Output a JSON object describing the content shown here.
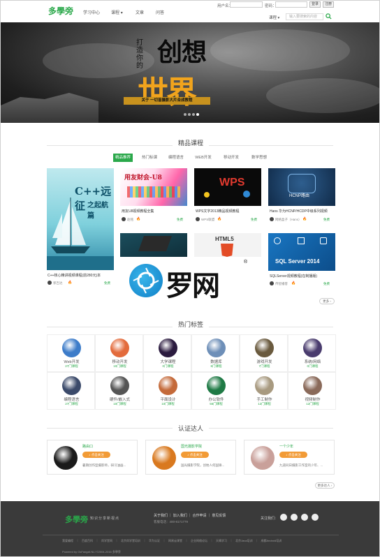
{
  "header": {
    "logo": "多學旁",
    "nav": [
      "学习中心",
      "课程",
      "文章",
      "问答"
    ],
    "login": {
      "username_label": "用户名：",
      "password_label": "密码：",
      "login_button": "登录",
      "register_button": "注册"
    },
    "course_select": "课程",
    "search_placeholder": "输入要搜索的内容"
  },
  "banner": {
    "small_text": "打造你的",
    "big_text_1": "创想",
    "big_text_2": "世界",
    "subtitle": "关于 一切皆摄影大片合成教程",
    "dots": 4,
    "active_dot": 3
  },
  "featured": {
    "title": "精品课程",
    "tabs": [
      "精品推荐",
      "热门标课",
      "编程语言",
      "WEB开发",
      "移动开发",
      "数学思想"
    ],
    "active_tab": 0,
    "big_card": {
      "title": "C++核心精讲视频课程(前280元)本",
      "author": "郭吉达",
      "price": "免费",
      "cover_text_1": "C++远征",
      "cover_text_2": "之起航篇"
    },
    "cards": [
      {
        "title": "用友U8视频教程全集",
        "author": "赵铭",
        "price": "免费",
        "cover": "用友财会-U8"
      },
      {
        "title": "WPS文字2013精品视频教程",
        "author": "WPS联盟",
        "price": "免费",
        "cover": "WPS"
      },
      {
        "title": "Hans 华为HCNP/HCDP中级系列视频",
        "author": "网络盒子（Hans）",
        "price": "免费",
        "cover": "HCNP路由"
      },
      {
        "title": "",
        "author": "",
        "price": "",
        "cover": ""
      },
      {
        "title": "",
        "author": "",
        "price": "",
        "cover": "HTML5"
      },
      {
        "title": "SQLServer视频教程(在制播版)",
        "author": "传智播客",
        "price": "免费",
        "cover": "SQL Server 2014"
      }
    ],
    "more_button": "更多 ›"
  },
  "watermark": {
    "text": "罗网",
    "reg": "®"
  },
  "tags": {
    "title": "热门标签",
    "items": [
      {
        "name": "Web开发",
        "count": "27门课程",
        "color": "#3d7cc9"
      },
      {
        "name": "移动开发",
        "count": "10门课程",
        "color": "#e36b3c"
      },
      {
        "name": "大学课程",
        "count": "0门课程",
        "color": "#2b1b3f"
      },
      {
        "name": "数据库",
        "count": "8门课程",
        "color": "#6e8fb8"
      },
      {
        "name": "游戏开发",
        "count": "7门课程",
        "color": "#6a5a3e"
      },
      {
        "name": "系统/网络",
        "count": "0门课程",
        "color": "#4a3c6e"
      },
      {
        "name": "编程语言",
        "count": "27门课程",
        "color": "#3b4a6a"
      },
      {
        "name": "硬件/嵌入式",
        "count": "10门课程",
        "color": "#555555"
      },
      {
        "name": "平面设计",
        "count": "10门课程",
        "color": "#c46a3a"
      },
      {
        "name": "办公软件",
        "count": "56门课程",
        "color": "#1f7a45"
      },
      {
        "name": "手工制作",
        "count": "12门课程",
        "color": "#a89a80"
      },
      {
        "name": "视频制作",
        "count": "12门课程",
        "color": "#8a6a5a"
      }
    ]
  },
  "experts": {
    "title": "认证达人",
    "items": [
      {
        "name": "路由口",
        "button": "♪ 点击关注",
        "desc": "暑期创作型摄影师，研习油画...",
        "color": "#1a1a1a"
      },
      {
        "name": "国光摄影学院",
        "button": "♪ 点击关注",
        "desc": "国光摄影学院，创始人何国锋...",
        "color": "#d9791f"
      },
      {
        "name": "一个少年",
        "button": "♪ 点击关注",
        "desc": "九道同日摄影工作室的少年、...",
        "color": "#c9a09a"
      }
    ],
    "more_button": "更多达人 ›"
  },
  "footer": {
    "logo": "多學旁",
    "slogan": "知识分享新视点",
    "links": "关于我们 ｜ 加入我们 ｜ 合作申请 ｜ 意见反馈",
    "phone": "客服电话：400-8171779",
    "follow": "关注我们：",
    "partners": "我爱编程　｜　百度百科　｜　尚学堂网　｜　北京尚学堂培训　｜　华为认证　｜　网易云课堂　｜　企业网络论坛　｜　天晴学习　｜　北京Java培训　｜　成都Android培训",
    "copyright": "Powered by OsFangzii.NLI ©2004-2016 多學旁"
  },
  "colors": {
    "accent": "#2aa84a",
    "orange": "#f29b36",
    "footer_bg": "#3a3a3a"
  }
}
